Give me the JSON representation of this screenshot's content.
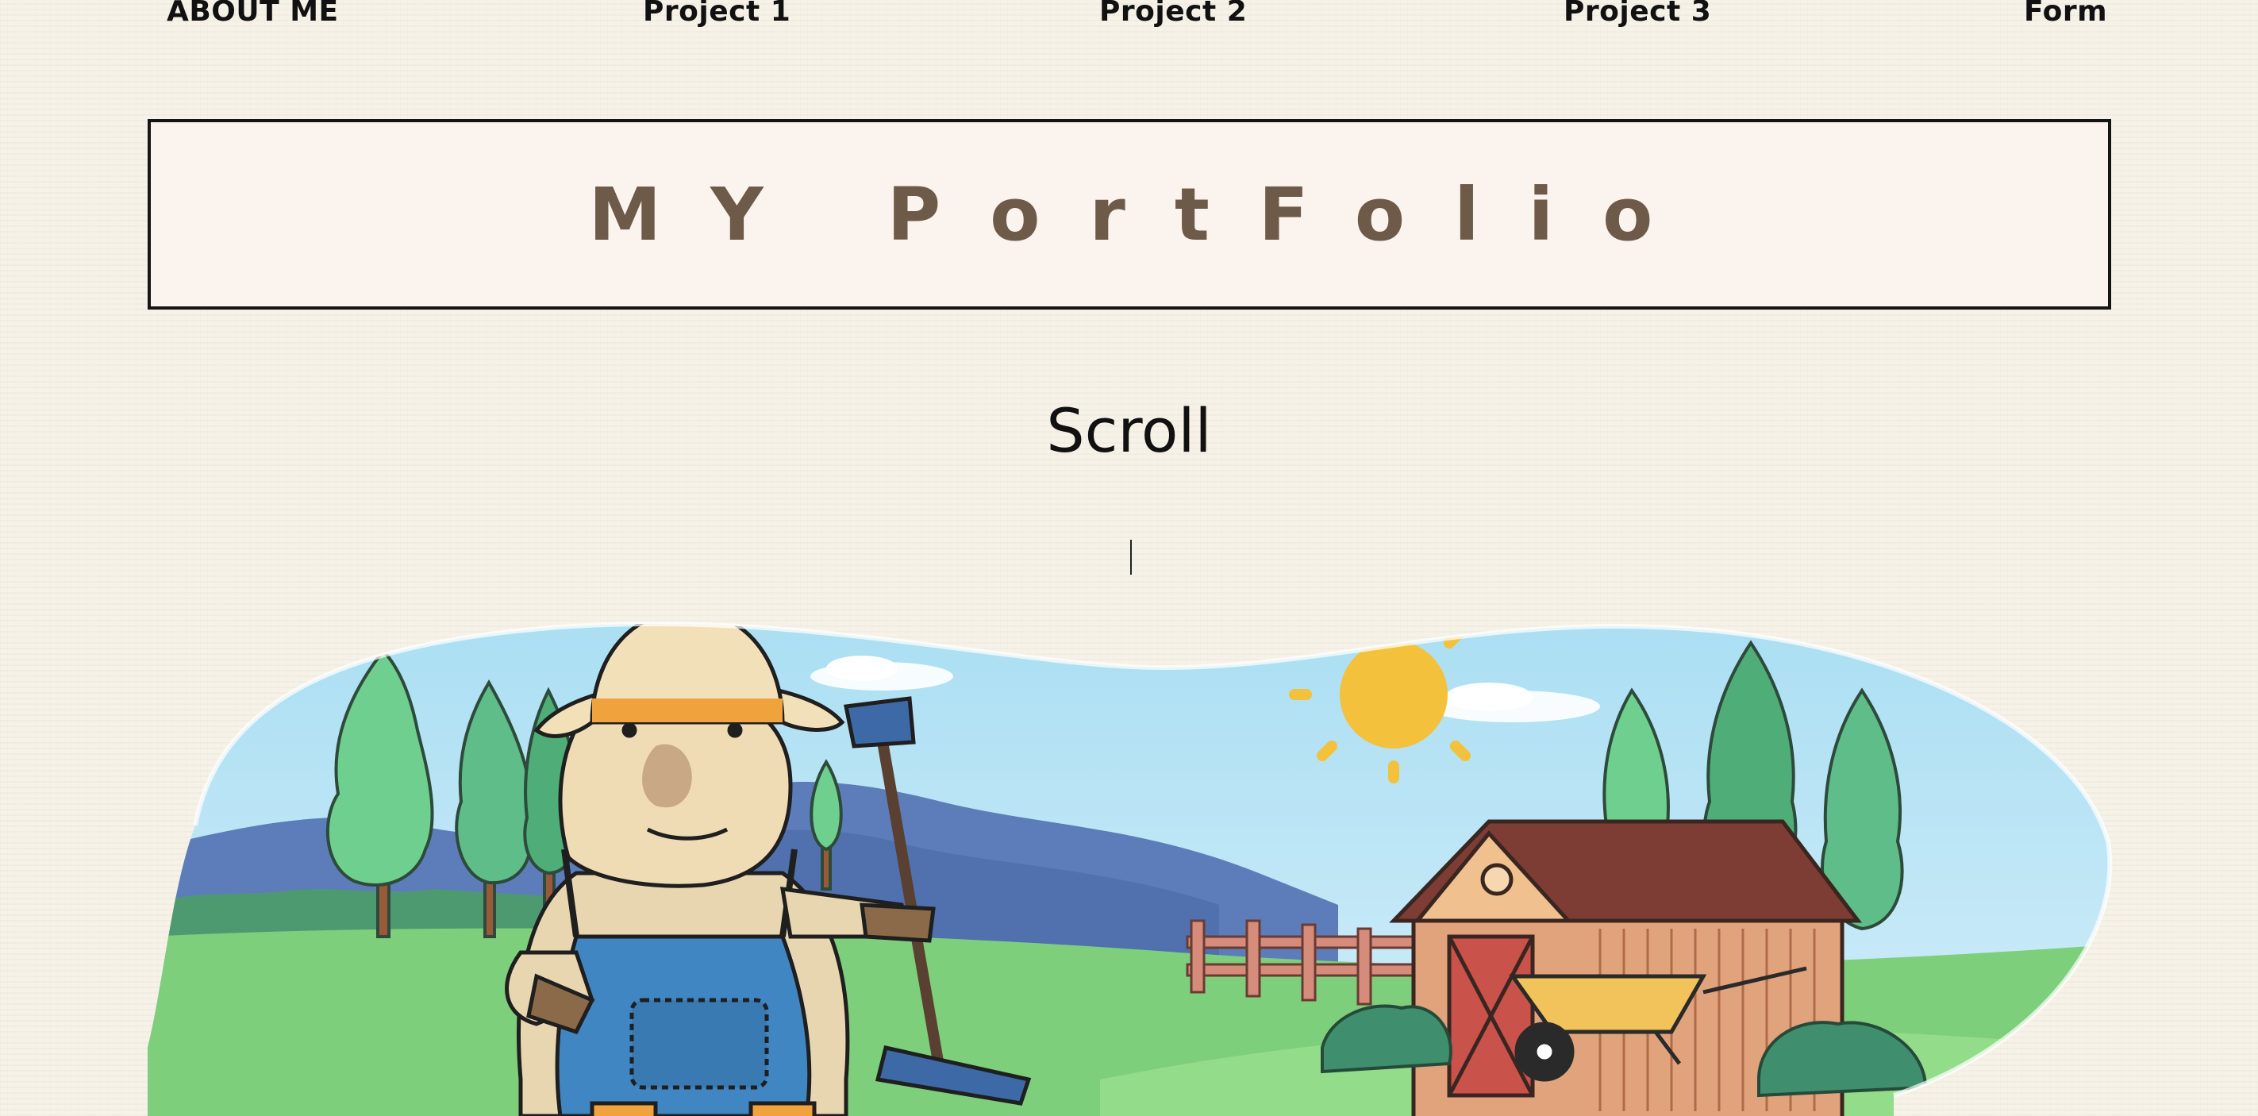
{
  "nav": {
    "items": [
      {
        "label": "ABOUT ME"
      },
      {
        "label": "Project 1"
      },
      {
        "label": "Project 2"
      },
      {
        "label": "Project 3"
      },
      {
        "label": "Form"
      }
    ]
  },
  "header": {
    "title": "MY PortFolio"
  },
  "scroll": {
    "label": "Scroll"
  },
  "colors": {
    "background": "#f6f2e8",
    "title_box_bg": "#fbf3ee",
    "title_text": "#6e5a48",
    "border": "#151515"
  }
}
